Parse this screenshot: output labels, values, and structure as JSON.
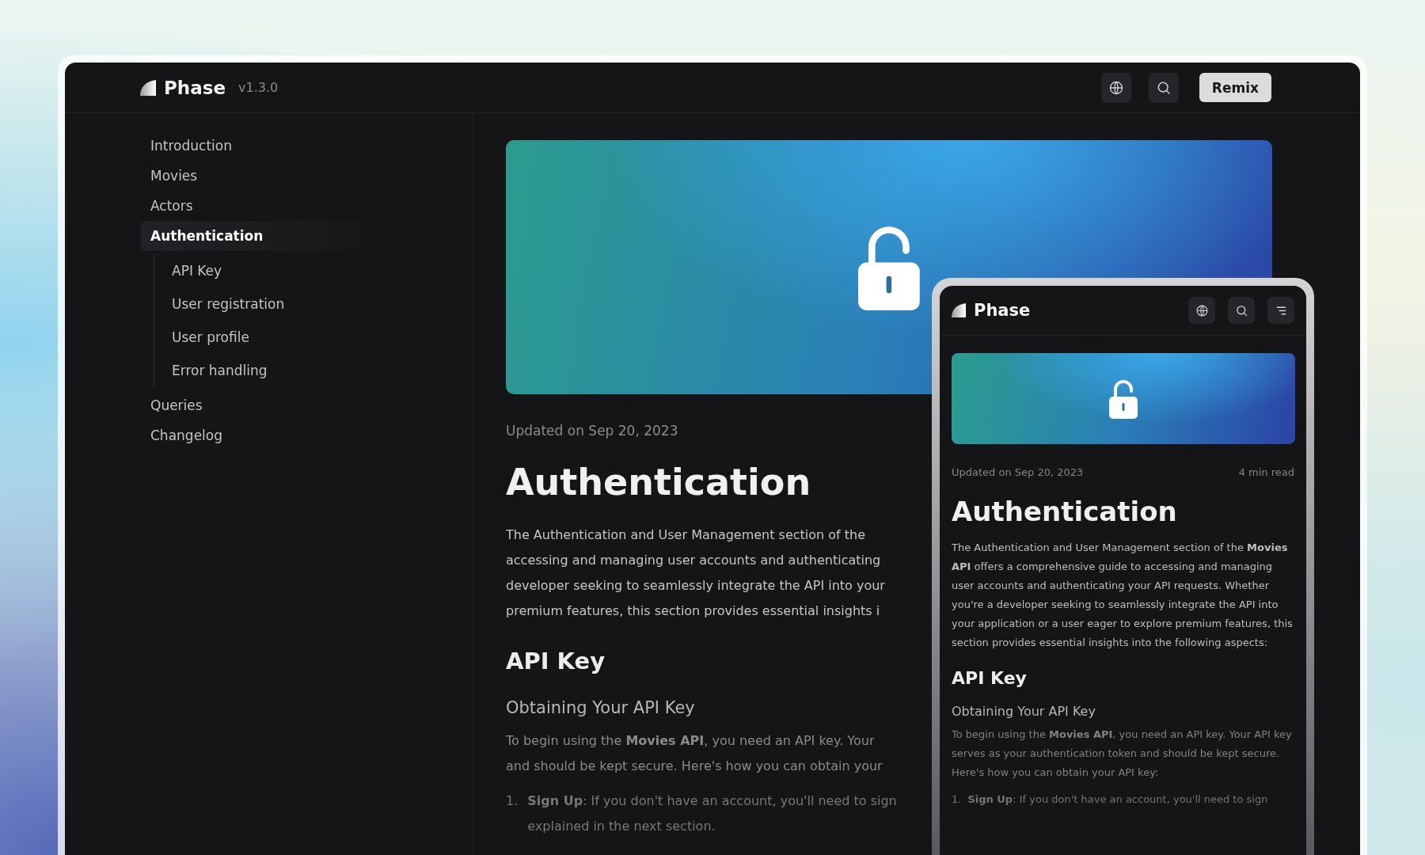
{
  "header": {
    "logo": "Phase",
    "version": "v1.3.0",
    "remix_button": "Remix"
  },
  "sidebar": {
    "items": [
      {
        "label": "Introduction",
        "selected": false
      },
      {
        "label": "Movies",
        "selected": false
      },
      {
        "label": "Actors",
        "selected": false
      },
      {
        "label": "Authentication",
        "selected": true,
        "children": [
          {
            "label": "API Key",
            "selected": false
          },
          {
            "label": "User registration",
            "selected": false
          },
          {
            "label": "User profile",
            "selected": false
          },
          {
            "label": "Error handling",
            "selected": false
          }
        ]
      },
      {
        "label": "Queries",
        "selected": false
      },
      {
        "label": "Changelog",
        "selected": false
      }
    ]
  },
  "article": {
    "updated": "Updated on Sep 20, 2023",
    "title": "Authentication",
    "intro_lines": [
      "The Authentication and User Management section of the",
      "accessing and managing user accounts and authenticating",
      "developer seeking to seamlessly integrate the API into your",
      "premium features, this section provides essential insights i"
    ],
    "heading": "API Key",
    "subheading": "Obtaining Your API Key",
    "para_lines": [
      "To begin using the **Movies API**, you need an API key. Your",
      "and should be kept secure. Here's how you can obtain your"
    ],
    "list": [
      {
        "number": "1.",
        "lines": [
          "**Sign Up**: If you don't have an account, you'll need to sign",
          "explained in the next section."
        ]
      }
    ]
  },
  "mobile": {
    "logo": "Phase",
    "updated": "Updated on Sep 20, 2023",
    "read_time": "4 min read",
    "title": "Authentication",
    "intro": "The Authentication and User Management section of the **Movies API** offers a comprehensive guide to accessing and managing user accounts and authenticating your API requests. Whether you're a developer seeking to seamlessly integrate the API into your application or a user eager to explore premium features, this section provides essential insights into the following aspects:",
    "heading": "API Key",
    "subheading": "Obtaining Your API Key",
    "para": "To begin using the **Movies API**, you need an API key. Your API key serves as your authentication token and should be kept secure. Here's how you can obtain your API key:",
    "list": [
      {
        "number": "1.",
        "text": "**Sign Up**: If you don't have an account, you'll need to sign"
      }
    ]
  }
}
